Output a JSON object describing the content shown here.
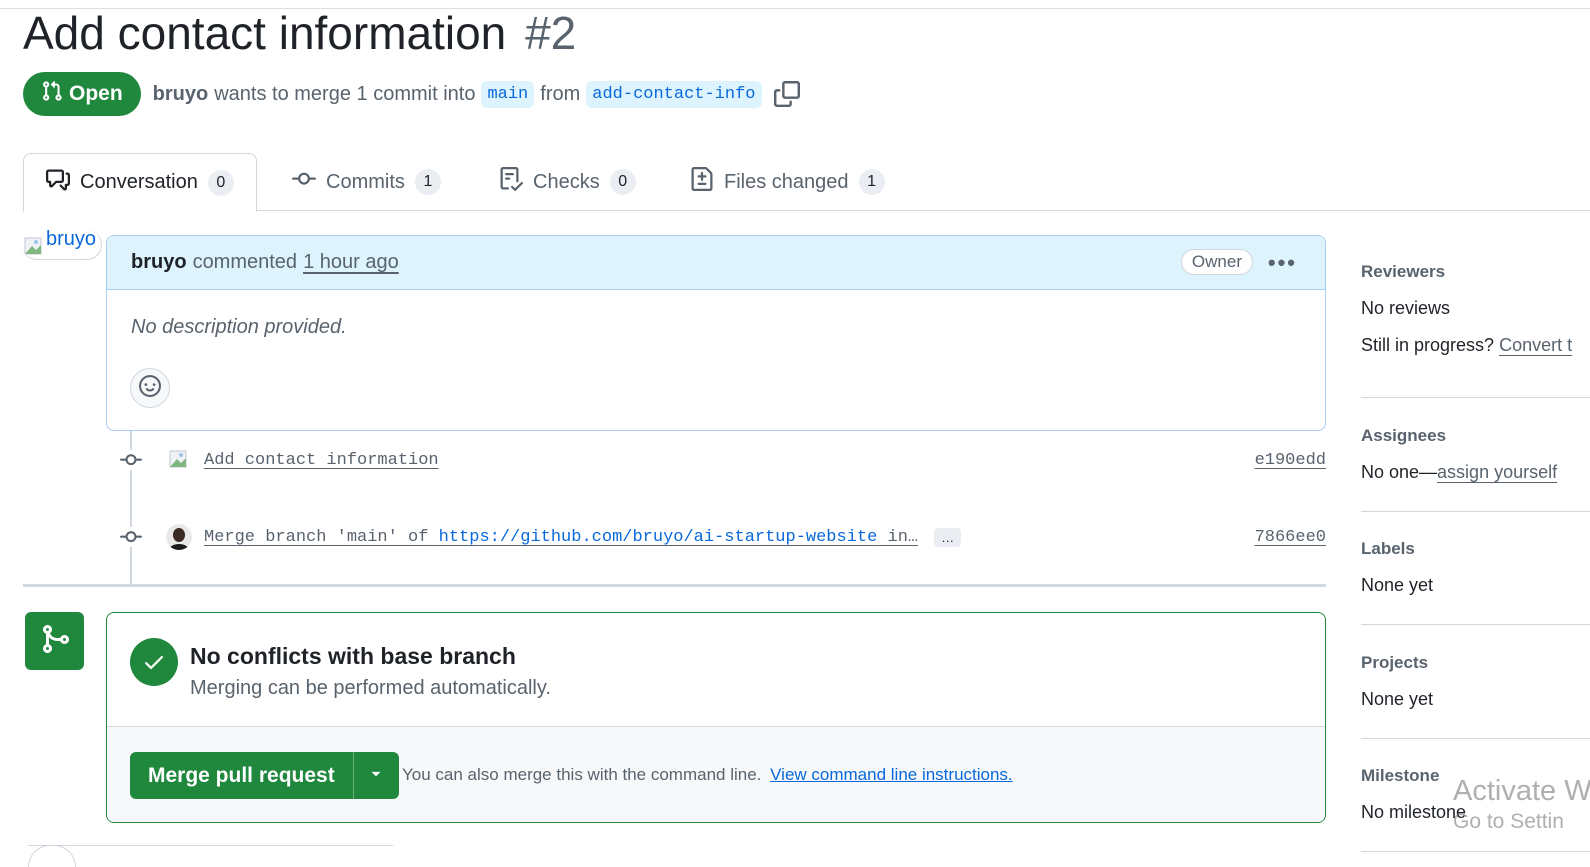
{
  "pr": {
    "title": "Add contact information",
    "number": "#2",
    "state": "Open",
    "author": "bruyo",
    "merge_text": "wants to merge 1 commit into",
    "base_branch": "main",
    "from_word": "from",
    "head_branch": "add-contact-info"
  },
  "tabs": [
    {
      "label": "Conversation",
      "count": "0",
      "icon": "comment-discussion-icon"
    },
    {
      "label": "Commits",
      "count": "1",
      "icon": "git-commit-icon"
    },
    {
      "label": "Checks",
      "count": "0",
      "icon": "checklist-icon"
    },
    {
      "label": "Files changed",
      "count": "1",
      "icon": "file-diff-icon"
    }
  ],
  "avatar_alt": "bruyo",
  "comment": {
    "author": "bruyo",
    "action": "commented",
    "time": "1 hour ago",
    "badge": "Owner",
    "body": "No description provided."
  },
  "commits": [
    {
      "message": "Add contact information",
      "sha": "e190edd"
    },
    {
      "message_prefix": "Merge branch 'main' of",
      "message_link": "https://github.com/bruyo/ai-startup-website",
      "message_suffix": "in…",
      "more": "…",
      "sha": "7866ee0"
    }
  ],
  "merge": {
    "title": "No conflicts with base branch",
    "subtitle": "Merging can be performed automatically.",
    "button": "Merge pull request",
    "hint": "You can also merge this with the command line.",
    "hint_link": "View command line instructions."
  },
  "sidebar": {
    "reviewers": {
      "title": "Reviewers",
      "value": "No reviews",
      "extra_prefix": "Still in progress?",
      "extra_link": "Convert t"
    },
    "assignees": {
      "title": "Assignees",
      "value_prefix": "No one—",
      "value_link": "assign yourself"
    },
    "labels": {
      "title": "Labels",
      "value": "None yet"
    },
    "projects": {
      "title": "Projects",
      "value": "None yet"
    },
    "milestone": {
      "title": "Milestone",
      "value": "No milestone"
    }
  },
  "watermark": {
    "line1": "Activate W",
    "line2": "Go to Settin"
  },
  "colors": {
    "green": "#1f883d",
    "blue": "#0969da",
    "muted": "#59636e",
    "header_bg": "#ddf4ff"
  }
}
